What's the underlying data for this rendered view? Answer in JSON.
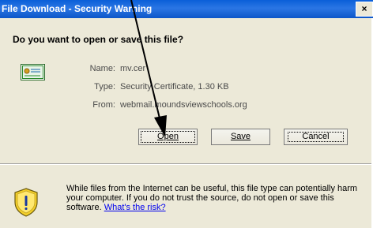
{
  "window": {
    "title": "File Download - Security Warning",
    "close_glyph": "×"
  },
  "dialog": {
    "question": "Do you want to open or save this file?",
    "fields": [
      {
        "label": "Name:",
        "value": "mv.cer"
      },
      {
        "label": "Type:",
        "value": "Security Certificate, 1.30 KB"
      },
      {
        "label": "From:",
        "value": "webmail.moundsviewschools.org"
      }
    ],
    "buttons": {
      "open": "Open",
      "save": "Save",
      "cancel": "Cancel"
    }
  },
  "warning": {
    "text": "While files from the Internet can be useful, this file type can potentially harm your computer. If you do not trust the source, do not open or save this software.",
    "link": "What's the risk?"
  },
  "colors": {
    "titlebar": "#0a5fd8",
    "dialog_bg": "#ece9d8",
    "link": "#0000ee"
  },
  "icons": {
    "file": "certificate-icon",
    "warning": "shield-warning-icon",
    "close": "close-icon"
  }
}
